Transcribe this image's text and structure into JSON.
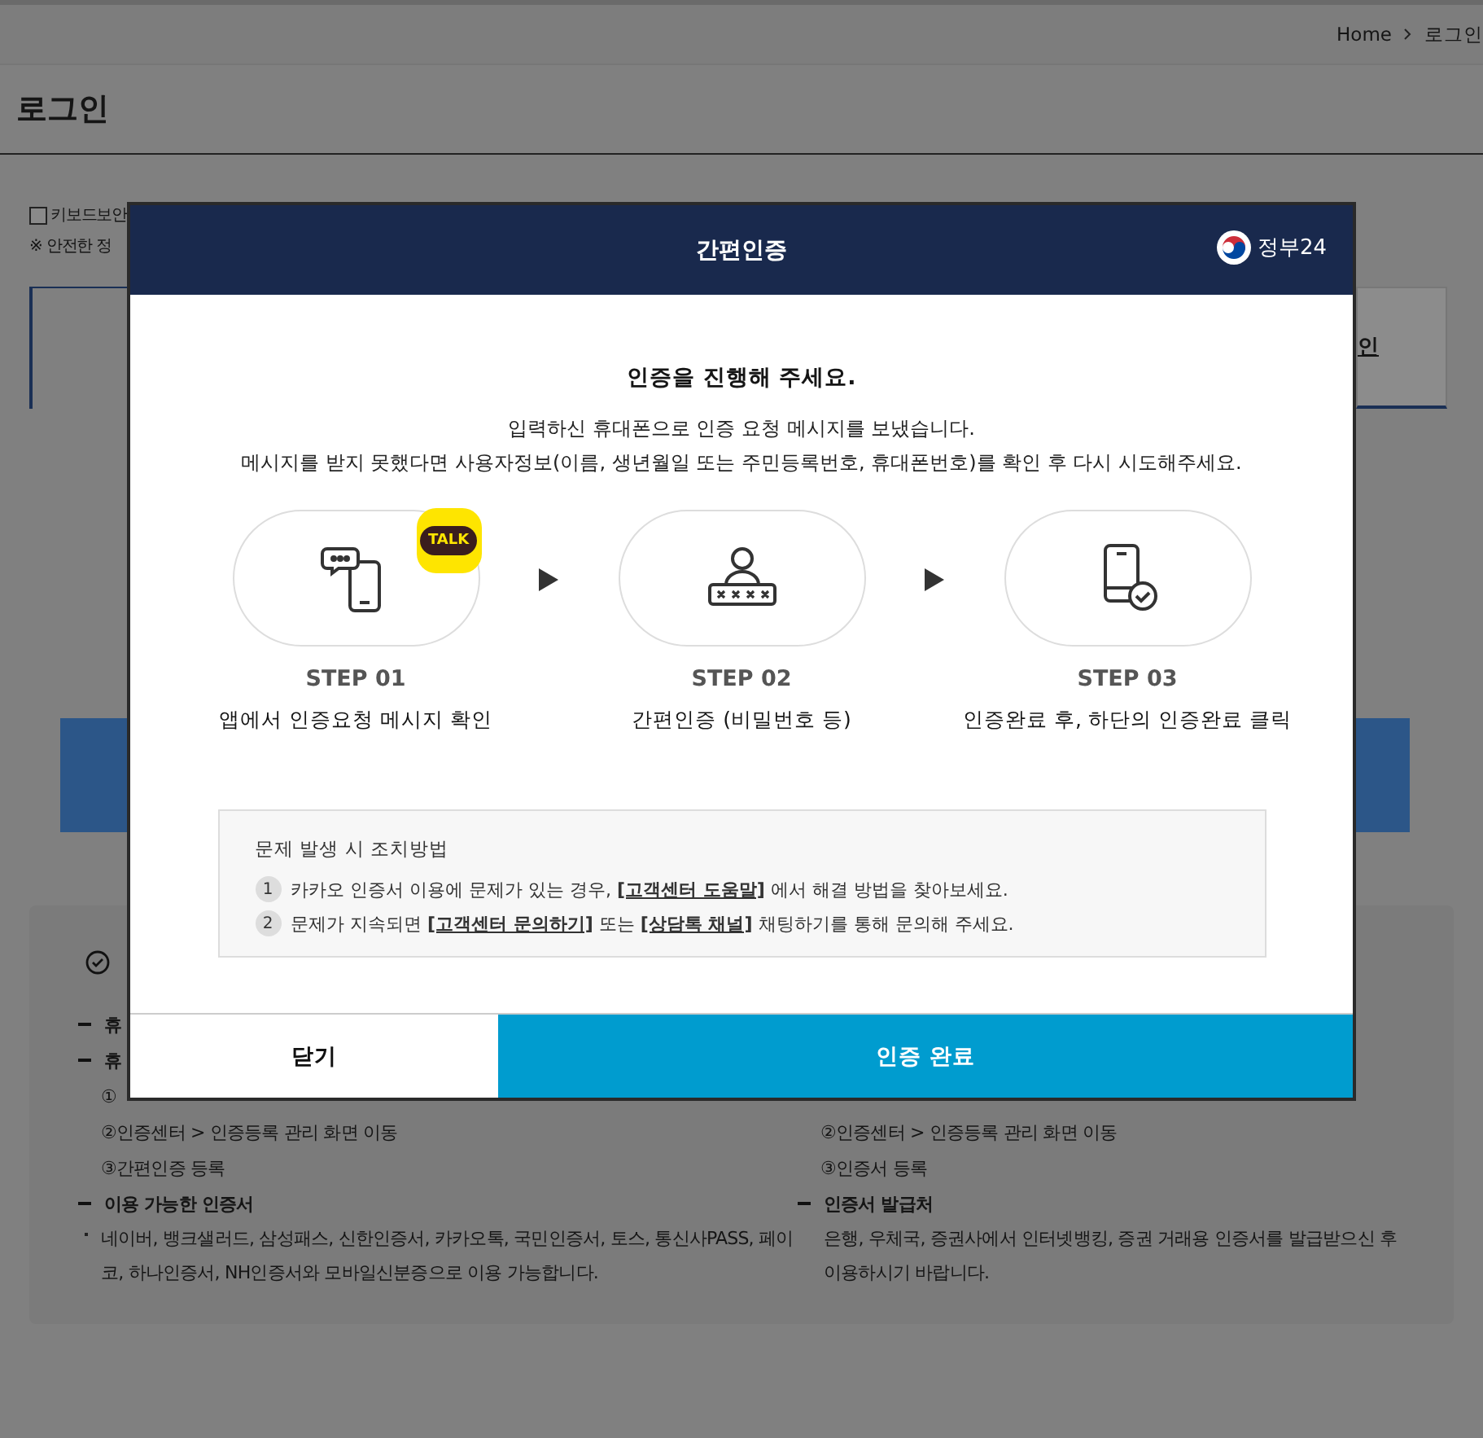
{
  "breadcrumb": [
    "Home",
    "로그인"
  ],
  "page_title": "로그인",
  "keyboard_security": {
    "label": "키보드보안",
    "checked": false
  },
  "notice": "※ 안전한 정",
  "login_button": "인",
  "info": {
    "left": [
      {
        "kind": "heading",
        "text": "휴"
      },
      {
        "kind": "heading",
        "text": "휴"
      },
      {
        "kind": "line",
        "text": "①"
      },
      {
        "kind": "line",
        "text": "②인증센터 > 인증등록 관리 화면 이동"
      },
      {
        "kind": "line",
        "text": "③간편인증 등록"
      },
      {
        "kind": "heading",
        "text": "이용 가능한 인증서"
      },
      {
        "kind": "bullet",
        "text": "네이버, 뱅크샐러드, 삼성패스, 신한인증서, 카카오톡, 국민인증서, 토스, 통신사PASS, 페이코, 하나인증서, NH인증서와 모바일신분증으로 이용 가능합니다."
      }
    ],
    "right": [
      {
        "kind": "line",
        "text": "②인증센터 > 인증등록 관리 화면 이동"
      },
      {
        "kind": "line",
        "text": "③인증서 등록"
      },
      {
        "kind": "heading",
        "text": "인증서 발급처"
      },
      {
        "kind": "plain",
        "text": "은행, 우체국, 증권사에서 인터넷뱅킹, 증권 거래용 인증서를 발급받으신 후 이용하시기 바랍니다."
      }
    ]
  },
  "modal": {
    "title": "간편인증",
    "logo_text": "정부24",
    "heading": "인증을 진행해 주세요.",
    "lines": [
      "입력하신 휴대폰으로 인증 요청 메시지를 보냈습니다.",
      "메시지를 받지 못했다면 사용자정보(이름, 생년월일 또는 주민등록번호, 휴대폰번호)를 확인 후 다시 시도해주세요."
    ],
    "steps": [
      {
        "badge": "TALK",
        "label": "STEP 01",
        "caption": "앱에서 인증요청 메시지 확인"
      },
      {
        "label": "STEP 02",
        "caption": "간편인증 (비밀번호 등)"
      },
      {
        "label": "STEP 03",
        "caption": "인증완료 후, 하단의 인증완료 클릭"
      }
    ],
    "help": {
      "title": "문제 발생 시 조치방법",
      "items": [
        {
          "number": "1",
          "parts": [
            {
              "kind": "text",
              "text": "카카오 인증서 이용에 문제가 있는 경우, "
            },
            {
              "kind": "link",
              "text": "[고객센터 도움말]"
            },
            {
              "kind": "text",
              "text": " 에서 해결 방법을 찾아보세요."
            }
          ]
        },
        {
          "number": "2",
          "parts": [
            {
              "kind": "text",
              "text": "문제가 지속되면 "
            },
            {
              "kind": "link",
              "text": "[고객센터 문의하기]"
            },
            {
              "kind": "text",
              "text": " 또는 "
            },
            {
              "kind": "link",
              "text": "[상담톡 채널]"
            },
            {
              "kind": "text",
              "text": " 채팅하기를 통해 문의해 주세요."
            }
          ]
        }
      ]
    },
    "buttons": {
      "close": "닫기",
      "confirm": "인증 완료"
    }
  }
}
